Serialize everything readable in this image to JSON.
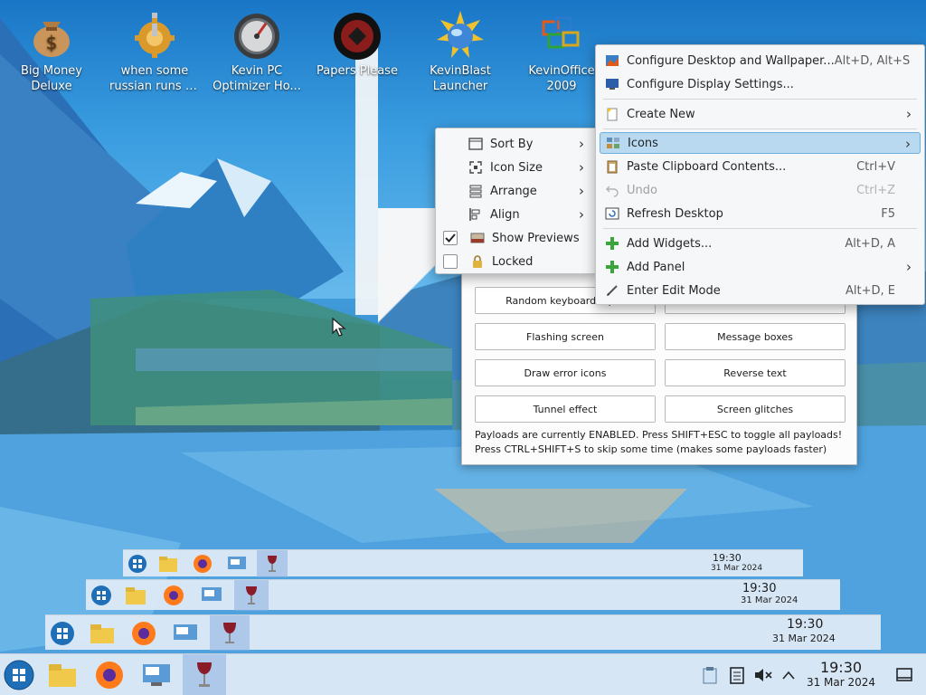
{
  "desktop_icons": [
    {
      "id": "big-money",
      "label": "Big Money\nDeluxe",
      "line1": "Big Money",
      "line2": "Deluxe"
    },
    {
      "id": "russian",
      "line1": "when some",
      "line2": "russian runs a..."
    },
    {
      "id": "optimizer",
      "line1": "Kevin PC",
      "line2": "Optimizer Ho..."
    },
    {
      "id": "papers",
      "line1": "Papers Please",
      "line2": ""
    },
    {
      "id": "launcher",
      "line1": "KevinBlast",
      "line2": "Launcher"
    },
    {
      "id": "office",
      "line1": "KevinOffice",
      "line2": "2009"
    }
  ],
  "payload_window": {
    "buttons": [
      "Random keyboard input",
      "",
      "Flashing screen",
      "Message boxes",
      "Draw error icons",
      "Reverse text",
      "Tunnel effect",
      "Screen glitches"
    ],
    "info_line1": "Payloads are currently ENABLED. Press SHIFT+ESC to toggle all payloads!",
    "info_line2": "Press CTRL+SHIFT+S to skip some time (makes some payloads faster)"
  },
  "context_menu": {
    "items": [
      {
        "label": "Configure Desktop and Wallpaper...",
        "shortcut": "Alt+D, Alt+S"
      },
      {
        "label": "Configure Display Settings...",
        "shortcut": ""
      },
      {
        "label": "Create New",
        "shortcut": ""
      },
      {
        "label": "Icons",
        "shortcut": ""
      },
      {
        "label": "Paste Clipboard Contents...",
        "shortcut": "Ctrl+V"
      },
      {
        "label": "Undo",
        "shortcut": "Ctrl+Z"
      },
      {
        "label": "Refresh Desktop",
        "shortcut": "F5"
      },
      {
        "label": "Add Widgets...",
        "shortcut": "Alt+D, A"
      },
      {
        "label": "Add Panel",
        "shortcut": ""
      },
      {
        "label": "Enter Edit Mode",
        "shortcut": "Alt+D, E"
      }
    ]
  },
  "icons_submenu": {
    "items": [
      {
        "label": "Sort By"
      },
      {
        "label": "Icon Size"
      },
      {
        "label": "Arrange"
      },
      {
        "label": "Align"
      },
      {
        "label": "Show Previews",
        "checked": true
      },
      {
        "label": "Locked",
        "checked": false
      }
    ]
  },
  "taskbar": {
    "time": "19:30",
    "date": "31 Mar 2024"
  },
  "colors": {
    "highlight": "#b8d9ef",
    "highlight_border": "#6bb0de",
    "menu_bg": "#f6f7f8",
    "taskbar_bg": "#e1ebf6"
  }
}
